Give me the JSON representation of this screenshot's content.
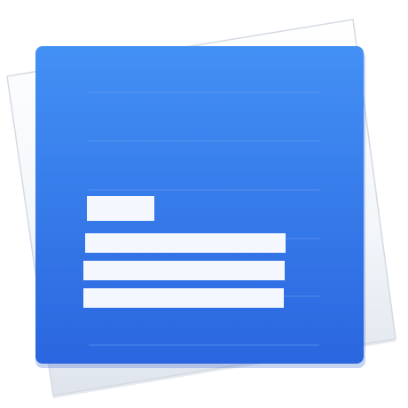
{
  "app_icon": {
    "name": "document-app-icon",
    "colors": {
      "background": "#ffffff",
      "back_sheet_light": "#fbfcfe",
      "back_sheet_dark": "#dde3ec",
      "back_sheet_edge": "#cfd6e0",
      "front_sheet_top": "#3f8bf3",
      "front_sheet_bottom": "#2b67e0",
      "text_lines": "#f4f8fe",
      "faint_rule": "#6fa6f5"
    }
  }
}
